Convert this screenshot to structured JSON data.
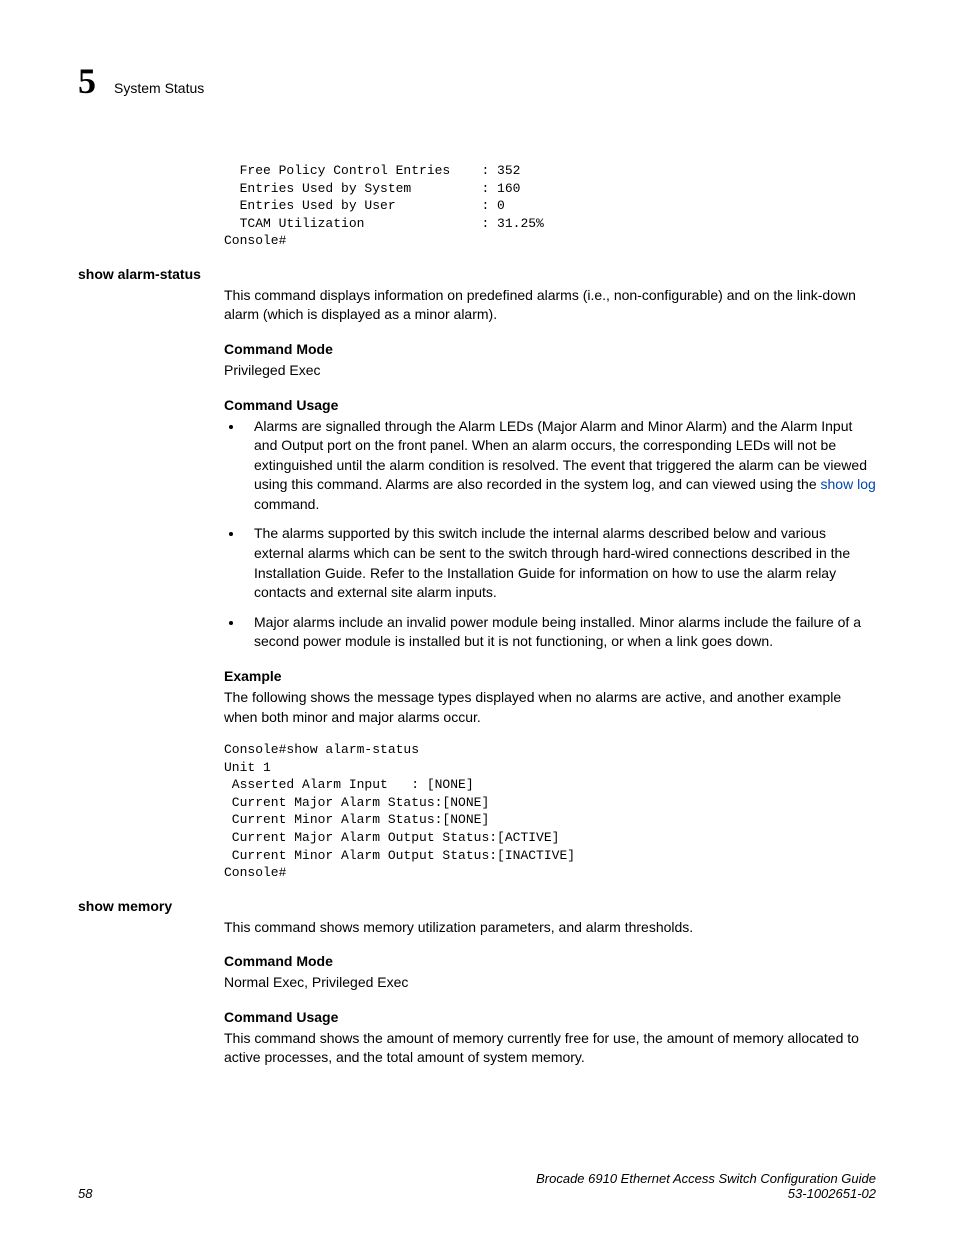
{
  "header": {
    "chapter_number": "5",
    "chapter_title": "System Status"
  },
  "codeblock1": "  Free Policy Control Entries    : 352\n  Entries Used by System         : 160\n  Entries Used by User           : 0\n  TCAM Utilization               : 31.25%\nConsole#",
  "sections": {
    "show_alarm": {
      "heading": "show alarm-status",
      "intro": "This command displays information on predefined alarms (i.e., non-configurable) and on the link-down alarm (which is displayed as a minor alarm).",
      "command_mode_label": "Command Mode",
      "command_mode": "Privileged Exec",
      "command_usage_label": "Command Usage",
      "bullet1_pre": "Alarms are signalled through the Alarm LEDs (Major Alarm and Minor Alarm) and the Alarm Input and Output port on the front panel. When an alarm occurs, the corresponding LEDs will not be extinguished until the alarm condition is resolved. The event that triggered the alarm can be viewed using this command. Alarms are also recorded in the system log, and can viewed using the ",
      "bullet1_link": "show log",
      "bullet1_post": " command.",
      "bullet2": "The alarms supported by this switch include the internal alarms described below and various external alarms which can be sent to the switch through hard-wired connections described in the Installation Guide. Refer to the Installation Guide for information on how to use the alarm relay contacts and external site alarm inputs.",
      "bullet3": "Major alarms include an invalid power module being installed. Minor alarms include the failure of a second power module is installed but it is not functioning, or when a link goes down.",
      "example_label": "Example",
      "example_intro": "The following shows the message types displayed when no alarms are active, and another example when both minor and major alarms occur.",
      "example_code": "Console#show alarm-status\nUnit 1\n Asserted Alarm Input   : [NONE]\n Current Major Alarm Status:[NONE]\n Current Minor Alarm Status:[NONE]\n Current Major Alarm Output Status:[ACTIVE]\n Current Minor Alarm Output Status:[INACTIVE]\nConsole#"
    },
    "show_memory": {
      "heading": "show memory",
      "intro": "This command shows memory utilization parameters, and alarm thresholds.",
      "command_mode_label": "Command Mode",
      "command_mode": "Normal Exec, Privileged Exec",
      "command_usage_label": "Command Usage",
      "command_usage": "This command shows the amount of memory currently free for use, the amount of memory allocated to active processes, and the total amount of system memory."
    }
  },
  "footer": {
    "page_number": "58",
    "doc_title": "Brocade 6910 Ethernet Access Switch Configuration Guide",
    "doc_id": "53-1002651-02"
  }
}
